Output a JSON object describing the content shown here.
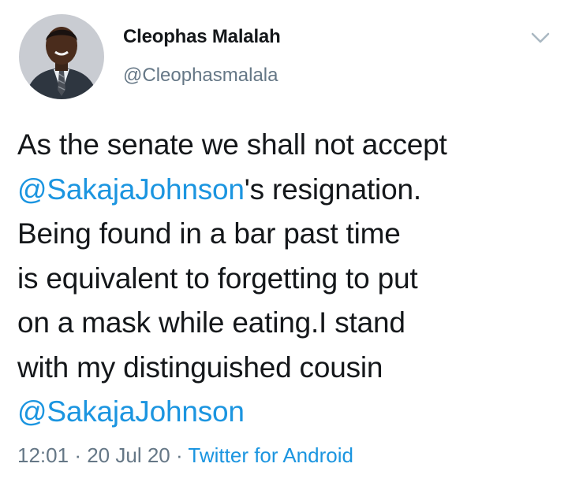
{
  "author": {
    "display_name": "Cleophas Malalah",
    "handle": "@Cleophasmalala",
    "avatar_icon": "profile-photo"
  },
  "menu": {
    "icon": "chevron-down-icon"
  },
  "tweet": {
    "line1": "As the senate we shall not accept",
    "mention1": "@SakajaJohnson",
    "line2_suffix": "'s resignation.",
    "line3": "Being found in a bar past time",
    "line4": "is equivalent to forgetting to put",
    "line5": "on a mask while eating.I stand",
    "line6": "with my distinguished cousin",
    "mention2": "@SakajaJohnson"
  },
  "meta": {
    "time": "12:01",
    "separator": "·",
    "date": "20 Jul 20",
    "source": "Twitter for Android"
  },
  "colors": {
    "link": "#1b95e0",
    "secondary_text": "#657786",
    "primary_text": "#14171a"
  }
}
